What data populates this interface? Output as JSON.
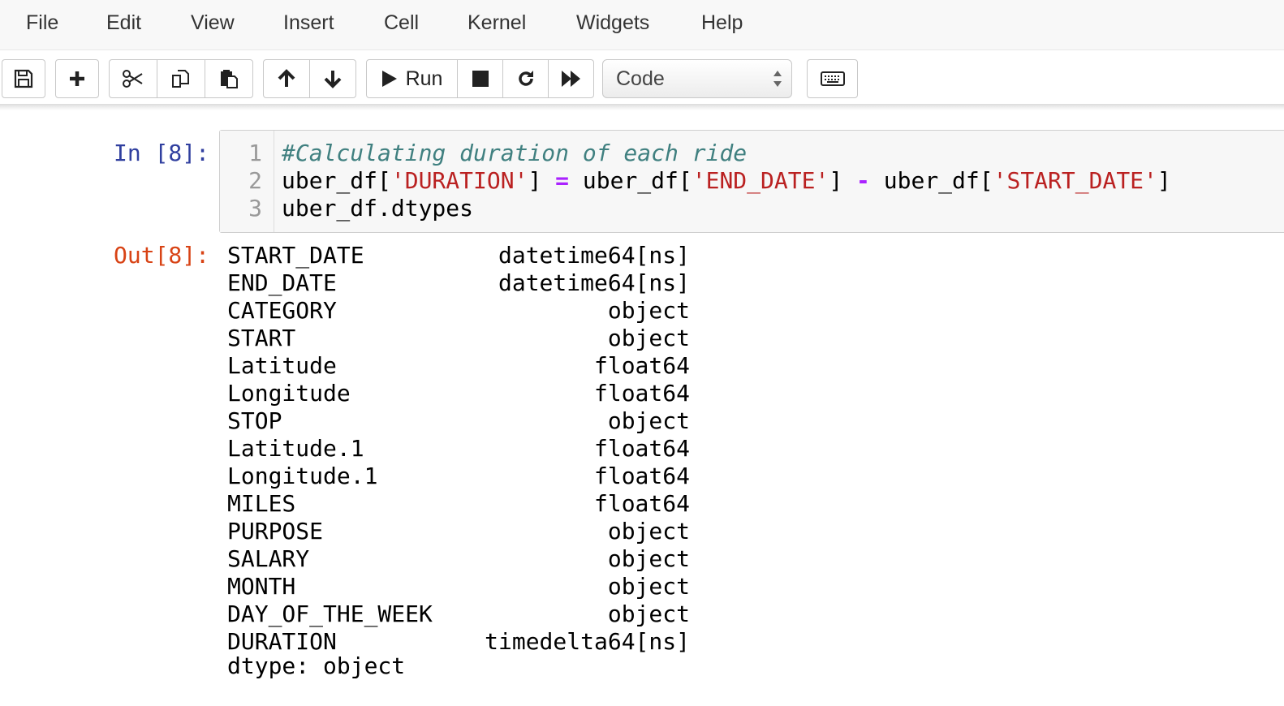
{
  "menu": [
    "File",
    "Edit",
    "View",
    "Insert",
    "Cell",
    "Kernel",
    "Widgets",
    "Help"
  ],
  "toolbar": {
    "run_label": "Run",
    "cell_type_selected": "Code"
  },
  "cell": {
    "in_prompt": "In [8]:",
    "out_prompt": "Out[8]:",
    "line_numbers": [
      "1",
      "2",
      "3"
    ],
    "code": {
      "line1_comment": "#Calculating duration of each ride",
      "line2": {
        "part1": "uber_df[",
        "str1": "'DURATION'",
        "part2": "] ",
        "op1": "=",
        "part3": " uber_df[",
        "str2": "'END_DATE'",
        "part4": "] ",
        "op2": "-",
        "part5": " uber_df[",
        "str3": "'START_DATE'",
        "part6": "]"
      },
      "line3": "uber_df.dtypes"
    },
    "output": {
      "rows": [
        {
          "name": "START_DATE",
          "dtype": "datetime64[ns]"
        },
        {
          "name": "END_DATE",
          "dtype": "datetime64[ns]"
        },
        {
          "name": "CATEGORY",
          "dtype": "object"
        },
        {
          "name": "START",
          "dtype": "object"
        },
        {
          "name": "Latitude",
          "dtype": "float64"
        },
        {
          "name": "Longitude",
          "dtype": "float64"
        },
        {
          "name": "STOP",
          "dtype": "object"
        },
        {
          "name": "Latitude.1",
          "dtype": "float64"
        },
        {
          "name": "Longitude.1",
          "dtype": "float64"
        },
        {
          "name": "MILES",
          "dtype": "float64"
        },
        {
          "name": "PURPOSE",
          "dtype": "object"
        },
        {
          "name": "SALARY",
          "dtype": "object"
        },
        {
          "name": "MONTH",
          "dtype": "object"
        },
        {
          "name": "DAY_OF_THE_WEEK",
          "dtype": "object"
        },
        {
          "name": "DURATION",
          "dtype": "timedelta64[ns]"
        }
      ],
      "footer": "dtype: object"
    }
  }
}
